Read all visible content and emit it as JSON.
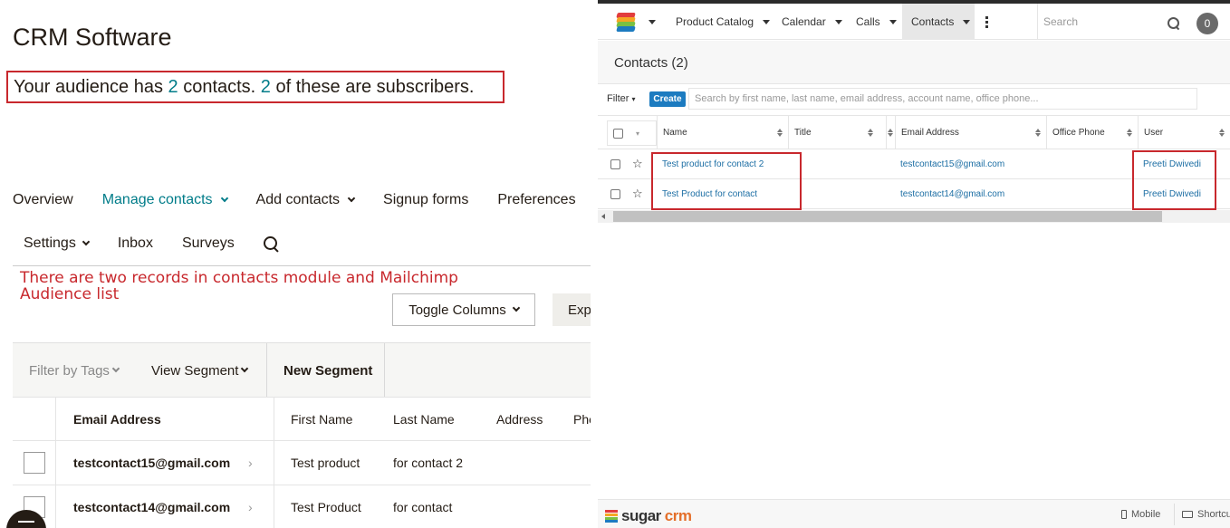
{
  "mailchimp": {
    "title": "CRM Software",
    "summary": {
      "prefix": "Your audience has ",
      "contacts_count": "2",
      "middle": " contacts. ",
      "subscribers_count": "2",
      "suffix": " of these are subscribers."
    },
    "nav": [
      "Overview",
      "Manage contacts",
      "Add contacts",
      "Signup forms",
      "Preferences"
    ],
    "nav2": [
      "Settings",
      "Inbox",
      "Surveys"
    ],
    "note": "There are two records in contacts module and Mailchimp Audience list",
    "toggle_columns": "Toggle Columns",
    "export_label": "Exp",
    "segment_bar": {
      "filter": "Filter by Tags",
      "view": "View Segment",
      "new": "New Segment"
    },
    "columns": [
      "Email Address",
      "First Name",
      "Last Name",
      "Address",
      "Pho"
    ],
    "rows": [
      {
        "email": "testcontact15@gmail.com",
        "first": "Test product",
        "last": "for contact 2"
      },
      {
        "email": "testcontact14@gmail.com",
        "first": "Test Product",
        "last": "for contact"
      }
    ],
    "accent_color": "#007c89",
    "annotation_color": "#c8282d"
  },
  "sugarcrm": {
    "tabs": [
      "Product Catalog",
      "Calendar",
      "Calls",
      "Contacts"
    ],
    "active_tab": "Contacts",
    "search_placeholder": "Search",
    "notification_count": "0",
    "module_title": "Contacts (2)",
    "filter_label": "Filter",
    "create_label": "Create",
    "quicksearch_placeholder": "Search by first name, last name, email address, account name, office phone...",
    "columns": [
      "Name",
      "Title",
      "Email Address",
      "Office Phone",
      "User"
    ],
    "rows": [
      {
        "name": "Test product for contact 2",
        "title": "",
        "email": "testcontact15@gmail.com",
        "phone": "",
        "user": "Preeti Dwivedi"
      },
      {
        "name": "Test Product for contact",
        "title": "",
        "email": "testcontact14@gmail.com",
        "phone": "",
        "user": "Preeti Dwivedi"
      }
    ],
    "footer": {
      "brand_sugar": "sugar",
      "brand_crm": "crm",
      "mobile": "Mobile",
      "shortcuts": "Shortcu"
    },
    "primary_color": "#1c7bc0"
  }
}
